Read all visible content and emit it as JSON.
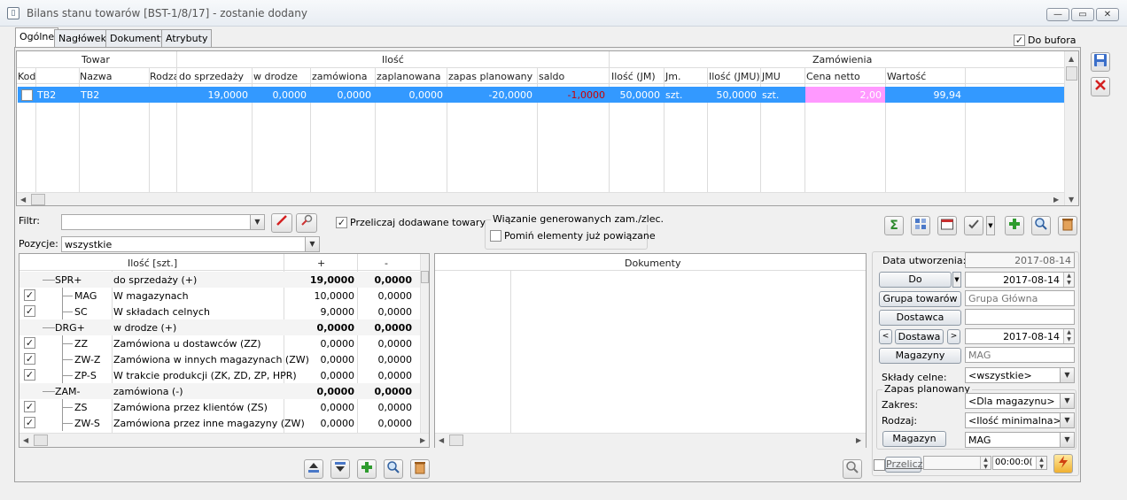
{
  "window": {
    "title": "Bilans stanu towarów [BST-1/8/17] - zostanie dodany",
    "title_glyph": "▯",
    "min": "—",
    "max": "▭",
    "close": "✕"
  },
  "tabs": [
    {
      "label": "Ogólne"
    },
    {
      "label": "Nagłówek"
    },
    {
      "label": "Dokumenty"
    },
    {
      "label": "Atrybuty"
    }
  ],
  "do_bufora": {
    "label": "Do bufora",
    "checked": "✓"
  },
  "grid": {
    "groups": {
      "towar": "Towar",
      "ilosc": "Ilość",
      "zamowienia": "Zamówienia"
    },
    "columns": [
      "Kod",
      "Nazwa",
      "Rodzaj",
      "do sprzedaży",
      "w drodze",
      "zamówiona",
      "zaplanowana",
      "zapas planowany",
      "saldo",
      "Ilość (JM)",
      "Jm.",
      "Ilość (JMU)",
      "JMU",
      "Cena netto",
      "Wartość"
    ],
    "row": {
      "kod": "TB2",
      "nazwa": "TB2",
      "rodzaj": "",
      "do_sprzedazy": "19,0000",
      "w_drodze": "0,0000",
      "zamowiona": "0,0000",
      "zaplanowana": "0,0000",
      "zapas_planowany": "-20,0000",
      "saldo": "-1,0000",
      "ilosc_jm": "50,0000",
      "jm": "szt.",
      "ilosc_jmu": "50,0000",
      "jmu": "szt.",
      "cena_netto": "2,00",
      "wartosc": "99,94"
    }
  },
  "filters": {
    "filtr_label": "Filtr:",
    "filtr_value": "",
    "pozycje_label": "Pozycje:",
    "pozycje_value": "wszystkie",
    "przeliczaj_label": "Przeliczaj dodawane towary",
    "przeliczaj_checked": "✓",
    "wiazanie_title": "Wiązanie generowanych zam./zlec.",
    "pomin_label": "Pomiń elementy już powiązane"
  },
  "tree": {
    "headers": {
      "ilosc": "Ilość [szt.]",
      "plus": "+",
      "minus": "-"
    },
    "rows": [
      {
        "code": "SPR+",
        "desc": "do sprzedaży (+)",
        "plus": "19,0000",
        "minus": "0,0000",
        "bold": true,
        "checked": ""
      },
      {
        "code": "MAG",
        "desc": "W magazynach",
        "plus": "10,0000",
        "minus": "0,0000",
        "bold": false,
        "checked": "✓"
      },
      {
        "code": "SC",
        "desc": "W składach celnych",
        "plus": "9,0000",
        "minus": "0,0000",
        "bold": false,
        "checked": "✓"
      },
      {
        "code": "DRG+",
        "desc": "w drodze (+)",
        "plus": "0,0000",
        "minus": "0,0000",
        "bold": true,
        "checked": ""
      },
      {
        "code": "ZZ",
        "desc": "Zamówiona u dostawców (ZZ)",
        "plus": "0,0000",
        "minus": "0,0000",
        "bold": false,
        "checked": "✓"
      },
      {
        "code": "ZW-Z",
        "desc": "Zamówiona w innych magazynach (ZW)",
        "plus": "0,0000",
        "minus": "0,0000",
        "bold": false,
        "checked": "✓"
      },
      {
        "code": "ZP-S",
        "desc": "W trakcie produkcji (ZK, ZD, ZP, HPR)",
        "plus": "0,0000",
        "minus": "0,0000",
        "bold": false,
        "checked": "✓"
      },
      {
        "code": "ZAM-",
        "desc": "zamówiona (-)",
        "plus": "0,0000",
        "minus": "0,0000",
        "bold": true,
        "checked": ""
      },
      {
        "code": "ZS",
        "desc": "Zamówiona przez klientów (ZS)",
        "plus": "0,0000",
        "minus": "0,0000",
        "bold": false,
        "checked": "✓"
      },
      {
        "code": "ZW-S",
        "desc": "Zamówiona przez inne magazyny (ZW)",
        "plus": "0,0000",
        "minus": "0,0000",
        "bold": false,
        "checked": "✓"
      }
    ]
  },
  "docs": {
    "title": "Dokumenty"
  },
  "right": {
    "data_utworzenia_label": "Data utworzenia:",
    "data_utworzenia": "2017-08-14",
    "do_label": "Do",
    "do_date": "2017-08-14",
    "grupa_label": "Grupa towarów",
    "grupa_value": "Grupa Główna",
    "dostawca_label": "Dostawca",
    "dostawca_value": "",
    "dostawa_label": "Dostawa",
    "dostawa_date": "2017-08-14",
    "magazyny_label": "Magazyny",
    "magazyny_value": "MAG",
    "sklady_label": "Składy celne:",
    "sklady_value": "<wszystkie>",
    "zapas_title": "Zapas planowany",
    "zakres_label": "Zakres:",
    "zakres_value": "<Dla magazynu>",
    "rodzaj_label": "Rodzaj:",
    "rodzaj_value": "<Ilość minimalna>",
    "magazyn_label": "Magazyn",
    "magazyn_value": "MAG",
    "przelicz_label": "Przelicz",
    "przelicz_value": "",
    "przelicz_time": "00:00:0("
  },
  "colors": {
    "selection": "#3399ff",
    "saldo_negative": "#cc0000",
    "price_highlight": "#ff99ff"
  }
}
